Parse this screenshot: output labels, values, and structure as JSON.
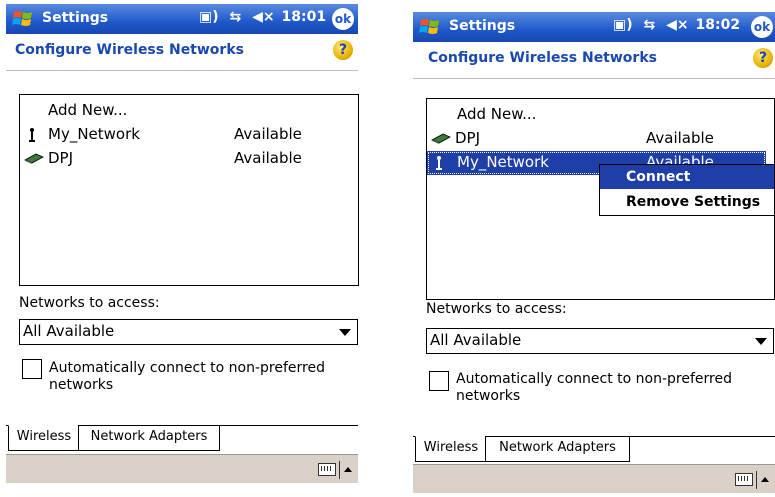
{
  "screens": [
    {
      "app_title": "Settings",
      "clock": "18:01",
      "ok_label": "ok",
      "subtitle": "Configure Wireless Networks",
      "help_label": "?",
      "add_new": "Add New...",
      "networks": [
        {
          "name": "My_Network",
          "status": "Available",
          "icon": "infrastructure-network-icon"
        },
        {
          "name": "DPJ",
          "status": "Available",
          "icon": "adhoc-network-icon"
        }
      ],
      "networks_label": "Networks to access:",
      "networks_value": "All Available",
      "auto_connect_label_1": "Automatically connect to non-preferred",
      "auto_connect_label_2": "networks",
      "tabs": [
        "Wireless",
        "Network Adapters"
      ]
    },
    {
      "app_title": "Settings",
      "clock": "18:02",
      "ok_label": "ok",
      "subtitle": "Configure Wireless Networks",
      "help_label": "?",
      "add_new": "Add New...",
      "networks": [
        {
          "name": "DPJ",
          "status": "Available",
          "icon": "adhoc-network-icon"
        },
        {
          "name": "My_Network",
          "status": "Available",
          "icon": "infrastructure-network-icon",
          "selected": true
        }
      ],
      "context_menu": [
        "Connect",
        "Remove Settings"
      ],
      "networks_label": "Networks to access:",
      "networks_value": "All Available",
      "auto_connect_label_1": "Automatically connect to non-preferred",
      "auto_connect_label_2": "networks",
      "tabs": [
        "Wireless",
        "Network Adapters"
      ]
    }
  ]
}
